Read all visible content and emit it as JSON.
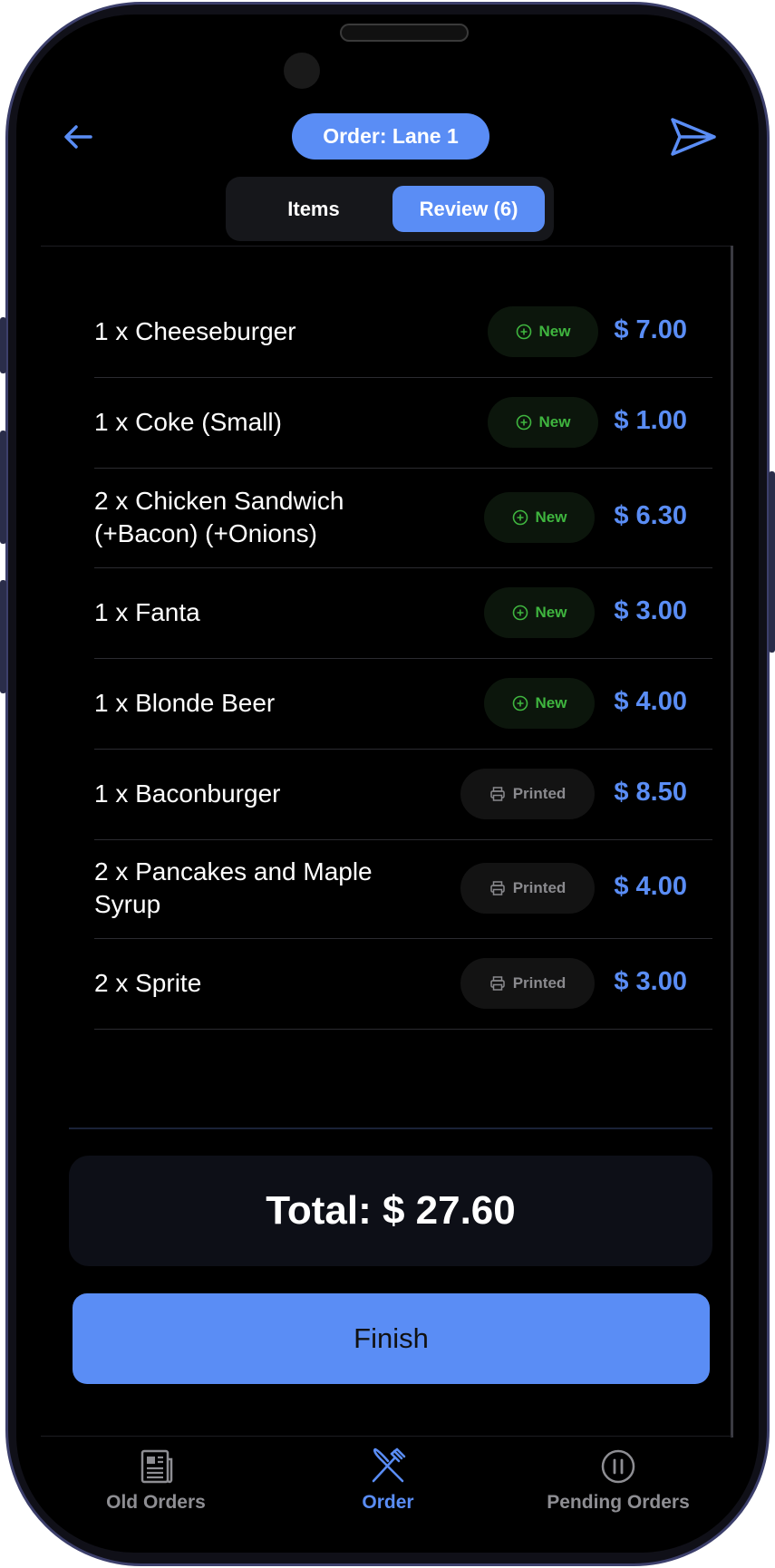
{
  "header": {
    "order_title": "Order: Lane 1"
  },
  "tabs": [
    {
      "label": "Items",
      "active": false
    },
    {
      "label": "Review (6)",
      "active": true
    }
  ],
  "items": [
    {
      "name": "1 x Cheeseburger",
      "status": "New",
      "price": "$ 7.00"
    },
    {
      "name": "1 x Coke (Small)",
      "status": "New",
      "price": "$ 1.00"
    },
    {
      "name": "2 x Chicken Sandwich\n(+Bacon) (+Onions)",
      "status": "New",
      "price": "$ 6.30"
    },
    {
      "name": "1 x Fanta",
      "status": "New",
      "price": "$ 3.00"
    },
    {
      "name": "1 x Blonde Beer",
      "status": "New",
      "price": "$ 4.00"
    },
    {
      "name": "1 x Baconburger",
      "status": "Printed",
      "price": "$ 8.50"
    },
    {
      "name": "2 x Pancakes and Maple\nSyrup",
      "status": "Printed",
      "price": "$ 4.00"
    },
    {
      "name": "2 x Sprite",
      "status": "Printed",
      "price": "$ 3.00"
    }
  ],
  "total_label": "Total: $ 27.60",
  "finish_label": "Finish",
  "bottom_nav": [
    {
      "label": "Old Orders",
      "icon": "newspaper-icon",
      "active": false
    },
    {
      "label": "Order",
      "icon": "fork-knife-icon",
      "active": true
    },
    {
      "label": "Pending Orders",
      "icon": "pause-circle-icon",
      "active": false
    }
  ],
  "colors": {
    "accent": "#5a8df5",
    "new_status": "#3fb53f",
    "printed_status": "#8a8a8e",
    "background": "#000000"
  }
}
